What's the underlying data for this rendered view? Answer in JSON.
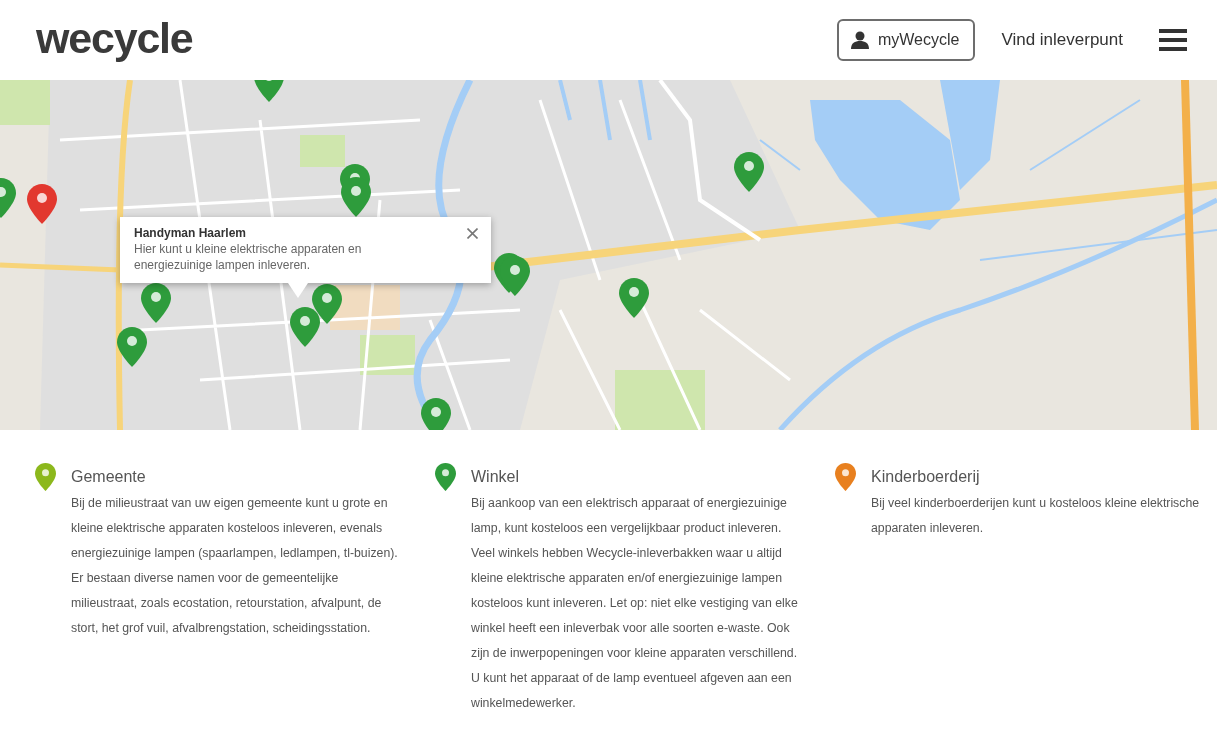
{
  "header": {
    "logo": "wecycle",
    "account_button": "myWecycle",
    "nav_link": "Vind inleverpunt"
  },
  "map": {
    "markers": [
      {
        "kind": "single",
        "color": "#2e9c3c"
      },
      {
        "kind": "pair",
        "color": "#2e9c3c"
      },
      {
        "kind": "single",
        "color": "#2e9c3c"
      },
      {
        "kind": "single",
        "color": "#e2382f"
      },
      {
        "kind": "single",
        "color": "#2e9c3c"
      },
      {
        "kind": "pair",
        "color": "#2e9c3c"
      },
      {
        "kind": "single",
        "color": "#2e9c3c"
      },
      {
        "kind": "single",
        "color": "#2e9c3c"
      },
      {
        "kind": "single",
        "color": "#2e9c3c"
      },
      {
        "kind": "single",
        "color": "#2e9c3c"
      },
      {
        "kind": "single",
        "color": "#2e9c3c"
      },
      {
        "kind": "single",
        "color": "#2e9c3c"
      }
    ],
    "info_window": {
      "title": "Handyman Haarlem",
      "text": "Hier kunt u kleine elektrische apparaten en energiezuinige lampen inleveren."
    }
  },
  "categories": [
    {
      "title": "Gemeente",
      "color": "#8cb81c",
      "text": "Bij de milieustraat van uw eigen gemeente kunt u grote en kleine elektrische apparaten kosteloos inleveren, evenals energiezuinige lampen (spaarlampen, ledlampen, tl-buizen). Er bestaan diverse namen voor de gemeentelijke milieustraat, zoals ecostation, retourstation, afvalpunt, de stort, het grof vuil, afvalbrengstation, scheidingsstation."
    },
    {
      "title": "Winkel",
      "color": "#2e9c3c",
      "text": "Bij aankoop van een elektrisch apparaat of energiezuinige lamp, kunt kosteloos een vergelijkbaar product inleveren. Veel winkels hebben Wecycle-inleverbakken waar u altijd kleine elektrische apparaten en/of energiezuinige lampen kosteloos kunt inleveren. Let op: niet elke vestiging van elke winkel heeft een inleverbak voor alle soorten e-waste. Ook zijn de inwerpopeningen voor kleine apparaten verschillend. U kunt het apparaat of de lamp eventueel afgeven aan een winkelmedewerker."
    },
    {
      "title": "Kinderboerderij",
      "color": "#e8801f",
      "text": "Bij veel kinderboerderijen kunt u kosteloos kleine elektrische apparaten inleveren."
    }
  ]
}
